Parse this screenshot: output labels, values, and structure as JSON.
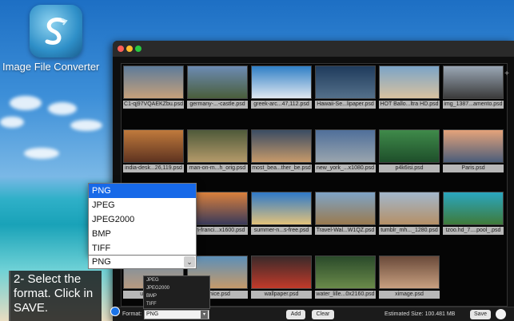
{
  "app": {
    "title": "Image File Converter"
  },
  "colors": {
    "accent": "#1769e8",
    "window_bg": "#0e0e0e"
  },
  "instruction": "2- Select the format. Click in SAVE.",
  "images": [
    {
      "name": "C1-qj97VQAEKZbu.psd",
      "colors": [
        "#5d7b9a",
        "#c6a07b"
      ]
    },
    {
      "name": "germany-...-castle.psd",
      "colors": [
        "#6c8bb3",
        "#4a5e3b"
      ]
    },
    {
      "name": "greek-arc...47,112.psd",
      "colors": [
        "#2f7fc6",
        "#e0e8f0"
      ]
    },
    {
      "name": "Hawaii-Se...lipaper.psd",
      "colors": [
        "#1f3b5c",
        "#54708a"
      ]
    },
    {
      "name": "HOT Ballo...ltra HD.psd",
      "colors": [
        "#7ba4c8",
        "#d9c2a0"
      ]
    },
    {
      "name": "img_1387...amento.psd",
      "colors": [
        "#9aa7b5",
        "#3b3b3b"
      ]
    },
    {
      "name": "india-desk...26,119.psd",
      "colors": [
        "#c07a3c",
        "#5e3320"
      ]
    },
    {
      "name": "man-on-m...h_orig.psd",
      "colors": [
        "#4f5a3a",
        "#b49a6a"
      ]
    },
    {
      "name": "most_bea...ther_be.psd",
      "colors": [
        "#3a4c63",
        "#c79a6a"
      ]
    },
    {
      "name": "new_york_...x1080.psd",
      "colors": [
        "#4f6f9a",
        "#9aa5ae"
      ]
    },
    {
      "name": "p4k6isi.psd",
      "colors": [
        "#3f8a4a",
        "#1e4f2a"
      ]
    },
    {
      "name": "Paris.psd",
      "colors": [
        "#e5a37a",
        "#4b5d7a"
      ]
    },
    {
      "name": "san-franci...x1600.psd",
      "colors": [
        "#d9803c",
        "#3a3a5a"
      ]
    },
    {
      "name": "summer-n...s-free.psd",
      "colors": [
        "#2e79c9",
        "#e2c27a"
      ]
    },
    {
      "name": "Travel-Wal...W1QZ.psd",
      "colors": [
        "#7ea4c6",
        "#9a7a4f"
      ]
    },
    {
      "name": "tumblr_mh..._1280.psd",
      "colors": [
        "#a2b8cc",
        "#b59066"
      ]
    },
    {
      "name": "tzoo.hd_7....pool_.psd",
      "colors": [
        "#2aa7c0",
        "#3f7a3a"
      ]
    },
    {
      "name": "usa_new...",
      "colors": [
        "#6f8ea8",
        "#b89a80"
      ]
    },
    {
      "name": "...nice.psd",
      "colors": [
        "#5c8fb8",
        "#c69a6a"
      ]
    },
    {
      "name": "wallpaper.psd",
      "colors": [
        "#3a2a2a",
        "#c23a2a"
      ]
    },
    {
      "name": "water_lille...0x2160.psd",
      "colors": [
        "#2a4a2a",
        "#6a8a4a"
      ]
    },
    {
      "name": "ximage.psd",
      "colors": [
        "#6a4a3a",
        "#c8a080"
      ]
    }
  ],
  "format_dropdown": {
    "options": [
      "PNG",
      "JPEG",
      "JPEG2000",
      "BMP",
      "TIFF"
    ],
    "selected": "PNG"
  },
  "mini_dropdown": {
    "options": [
      "JPEG",
      "JPEG2000",
      "BMP",
      "TIFF"
    ]
  },
  "bottombar": {
    "format_label": "Format:",
    "format_value": "PNG",
    "add_label": "Add",
    "clear_label": "Clear",
    "estimated_size": "Estimated Size: 100.481 MB",
    "save_label": "Save"
  }
}
